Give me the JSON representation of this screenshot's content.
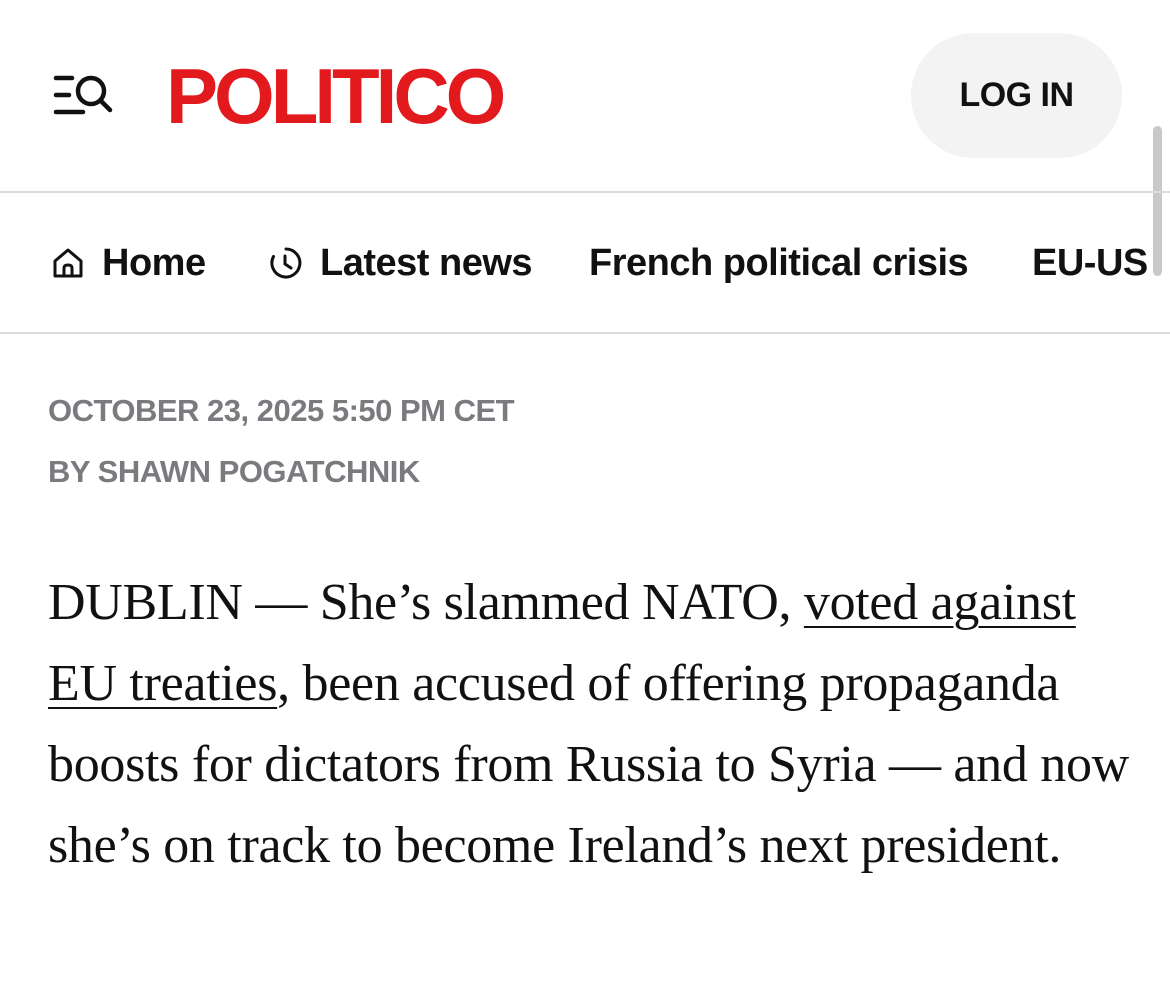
{
  "header": {
    "brand": "POLITICO",
    "brand_color": "#e2191d",
    "menu_icon": "menu-search-icon",
    "login_label": "LOG IN"
  },
  "nav": {
    "items": [
      {
        "label": "Home",
        "icon": "home-icon"
      },
      {
        "label": "Latest news",
        "icon": "clock-icon"
      },
      {
        "label": "French political crisis"
      },
      {
        "label": "EU-US"
      }
    ]
  },
  "article": {
    "date": "OCTOBER 23, 2025 5:50 PM CET",
    "byline_prefix": "BY",
    "author": "SHAWN POGATCHNIK",
    "body": {
      "part1": "DUBLIN — She’s slammed NATO, ",
      "link1": "voted against EU treaties",
      "part2": ", been accused of offering propaganda boosts for dictators from Russia to Syria — and now she’s on track to become Ireland’s next president."
    }
  }
}
